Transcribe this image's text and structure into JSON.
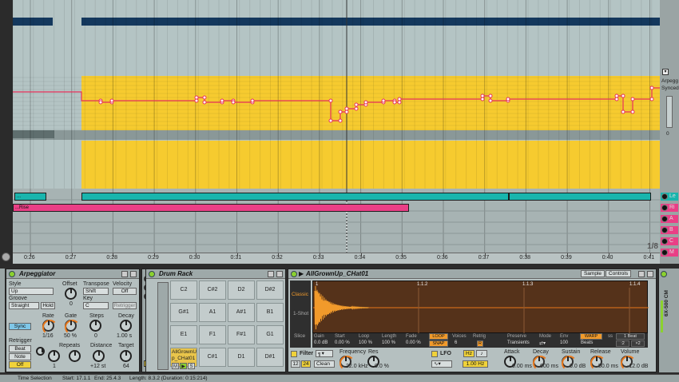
{
  "arrangement": {
    "ruler_ticks": [
      "0:26",
      "0:27",
      "0:28",
      "0:29",
      "0:30",
      "0:31",
      "0:32",
      "0:33",
      "0:34",
      "0:35",
      "0:36",
      "0:37",
      "0:38",
      "0:39",
      "0:40",
      "0:41"
    ],
    "grid_fraction": "1/8",
    "clips": {
      "teal_a": "...",
      "rise": "...Rise"
    },
    "automation_side": {
      "label1": "Arpegg",
      "label2": "Synced",
      "value": "0"
    },
    "track_letters": [
      "Le",
      "Ri",
      "A",
      "B",
      "C",
      "M"
    ],
    "colors": {
      "yellow": "#f6cb2f",
      "teal": "#19b5ad",
      "pink": "#ea3f86",
      "navy": "#14385d",
      "envelope": "#e8315a"
    }
  },
  "arpeggiator": {
    "title": "Arpeggiator",
    "style_label": "Style",
    "style_value": "Up",
    "groove_label": "Groove",
    "groove_value": "Straight",
    "hold_label": "Hold",
    "offset_label": "Offset",
    "offset_value": "0",
    "transpose_label": "Transpose",
    "transpose_mode": "Shift",
    "key_label": "Key",
    "key_value": "C",
    "velocity_label": "Velocity",
    "velocity_value": "Off",
    "retrigger_box": "Retrigger",
    "sync_label": "Sync",
    "rate_label": "Rate",
    "rate_value": "1/16",
    "gate_label": "Gate",
    "gate_value": "50 %",
    "steps_label": "Steps",
    "steps_value": "0",
    "decay_label": "Decay",
    "decay_value": "1.00 s",
    "retrigger_label": "Retrigger",
    "beat_label": "Beat",
    "note_label": "Note",
    "off_label": "Off",
    "repeats_label": "Repeats",
    "repeats_value": "1",
    "distance_label": "Distance",
    "distance_value": "+12 st",
    "target_label": "Target",
    "target_value": "64"
  },
  "drum_rack": {
    "title": "Drum Rack",
    "pads": [
      [
        "C2",
        "C#2",
        "D2",
        "D#2"
      ],
      [
        "G#1",
        "A1",
        "A#1",
        "B1"
      ],
      [
        "E1",
        "F1",
        "F#1",
        "G1"
      ],
      [
        "",
        "C#1",
        "D1",
        "D#1"
      ]
    ],
    "selected_pad": "AllGrownU p_CHat01",
    "selected_pad_buttons": [
      "M",
      "▶",
      "S"
    ]
  },
  "simpler": {
    "title": "AllGrownUp_CHat01",
    "tab_sample": "Sample",
    "tab_controls": "Controls",
    "mode_classic": "Classic",
    "mode_oneshot": "1-Shot",
    "mode_slice": "Slice",
    "wave_markers": [
      "1",
      "1.1.2",
      "1.1.3",
      "1.1.4"
    ],
    "gain_label": "Gain",
    "gain_value": "0.0 dB",
    "start_label": "Start",
    "start_value": "0.00 %",
    "loop_label": "Loop",
    "loop_value": "100 %",
    "length_label": "Length",
    "length_value": "100 %",
    "fade_label": "Fade",
    "fade_value": "0.00 %",
    "loop_btn": "LOOP",
    "snap_btn": "SNAP",
    "voices_label": "Voices",
    "voices_value": "6",
    "retrig_label": "Retrig",
    "retrig_value": "R",
    "preserve_label": "Preserve",
    "preserve_value": "Transients",
    "mode_label": "Mode",
    "env_label": "Env",
    "env_value": "100",
    "warp_btn": "WARP",
    "warp_mode": "Beats",
    "ss_label": "ss",
    "beat_value": "1 Beat",
    "half_btn": ":2",
    "double_btn": "×2",
    "filter_label": "Filter",
    "filter_12": "12",
    "filter_24": "24",
    "filter_type": "Clean",
    "freq_label": "Frequency",
    "freq_value": "22.0 kHz",
    "res_label": "Res",
    "res_value": "0.0 %",
    "lfo_label": "LFO",
    "lfo_hz": "Hz",
    "lfo_rate": "1.00 Hz",
    "attack_label": "Attack",
    "attack_value": "0.00 ms",
    "decay_label": "Decay",
    "decay_value": "600 ms",
    "sustain_label": "Sustain",
    "sustain_value": "0.0 dB",
    "release_label": "Release",
    "release_value": "50.0 ms",
    "volume_label": "Volume",
    "volume_value": "-12.0 dB",
    "side_label": "6X-500 CM"
  },
  "status": {
    "mode": "Time Selection",
    "start": "Start: 17.1.1",
    "end": "End: 25.4.3",
    "length": "Length: 8.3.2 (Duration: 0:15:214)"
  }
}
